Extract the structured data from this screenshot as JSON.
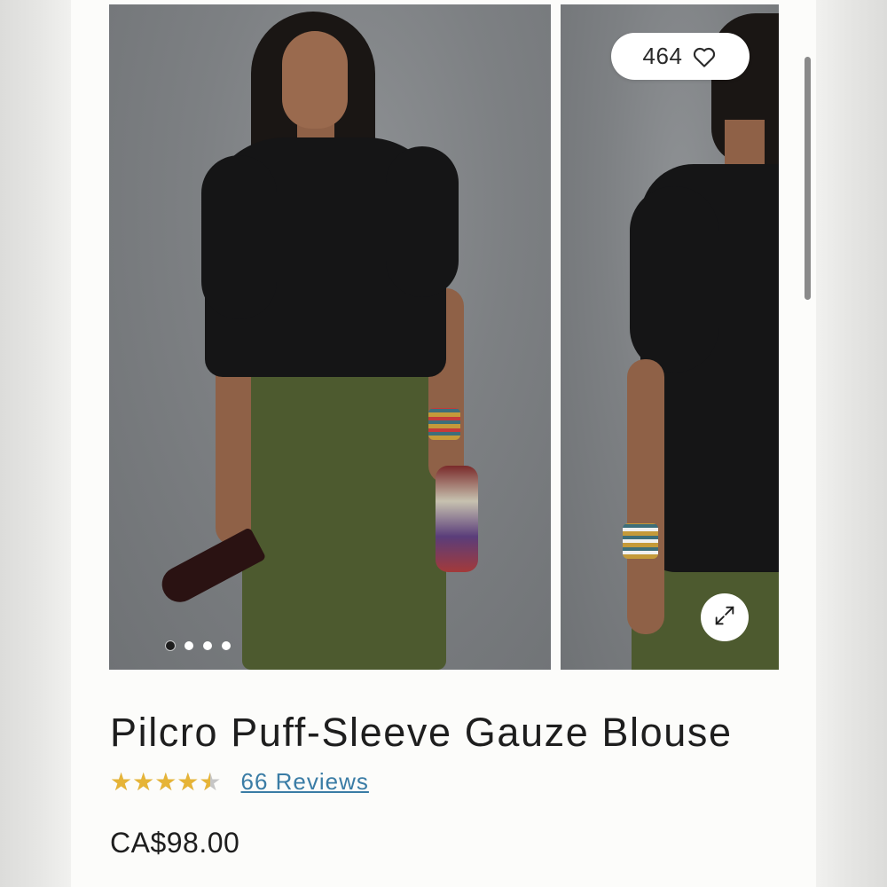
{
  "gallery": {
    "like_count": "464",
    "slide_count": 4,
    "active_slide": 1,
    "main_image_alt": "model wearing black puff-sleeve blouse and olive pants, front view",
    "side_image_alt": "model wearing black puff-sleeve blouse, back view"
  },
  "product": {
    "title": "Pilcro Puff-Sleeve Gauze Blouse",
    "rating": 4.5,
    "rating_max": 5,
    "reviews_label": "66 Reviews",
    "price": "CA$98.00"
  },
  "colors": {
    "accent_link": "#3a7ca5",
    "star": "#e6b437",
    "text": "#1e1e1e"
  },
  "icons": {
    "like": "heart-icon",
    "expand": "expand-icon",
    "star": "star-icon"
  }
}
